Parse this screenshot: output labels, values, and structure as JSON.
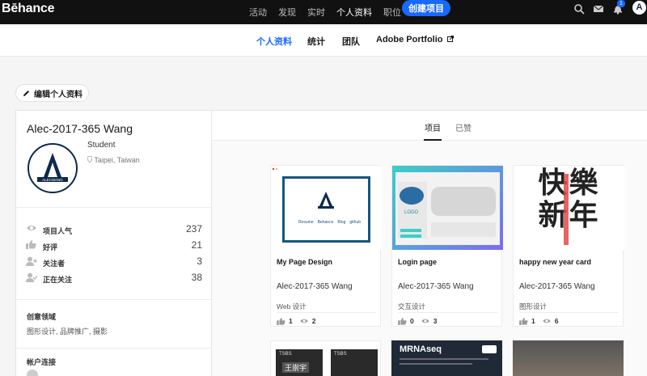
{
  "topbar": {
    "logo": "Bēhance",
    "nav": [
      "活动",
      "发现",
      "实时",
      "个人资料",
      "职位"
    ],
    "active_index": 3,
    "create_label": "创建项目",
    "notification_count": "1",
    "avatar_letter": "A"
  },
  "subnav": {
    "tabs": [
      "个人资料",
      "统计",
      "团队",
      "Adobe Portfolio"
    ],
    "active_index": 0
  },
  "edit_profile_label": "编辑个人资料",
  "profile": {
    "name": "Alec-2017-365 Wang",
    "occupation": "Student",
    "location": "Taipei, Taiwan",
    "avatar_text": "ALECWANG",
    "stats": [
      {
        "icon": "eye-icon",
        "label": "项目人气",
        "value": "237"
      },
      {
        "icon": "thumbs-up-icon",
        "label": "好评",
        "value": "21"
      },
      {
        "icon": "followers-icon",
        "label": "关注者",
        "value": "3"
      },
      {
        "icon": "following-icon",
        "label": "正在关注",
        "value": "38"
      }
    ],
    "creative_fields_title": "创意领域",
    "creative_fields": "图形设计, 品牌推广, 摄影",
    "accounts_title": "帐户连接"
  },
  "main": {
    "tabs": [
      "项目",
      "已赞"
    ],
    "active_index": 0,
    "projects": [
      {
        "title": "My Page Design",
        "owner": "Alec-2017-365 Wang",
        "field": "Web 设计",
        "likes": "1",
        "views": "2",
        "thumb_links": [
          "Resume",
          "Behance",
          "Blog",
          "github"
        ]
      },
      {
        "title": "Login page",
        "owner": "Alec-2017-365 Wang",
        "field": "交互设计",
        "likes": "0",
        "views": "3",
        "thumb_text": "LOGO"
      },
      {
        "title": "happy new year card",
        "owner": "Alec-2017-365 Wang",
        "field": "图形设计",
        "likes": "1",
        "views": "6",
        "thumb_text": "快樂新年"
      }
    ],
    "row2": [
      {
        "thumb_text_a": "TSBS",
        "thumb_text_b": "王崇宇"
      },
      {
        "thumb_text": "MRNAseq"
      }
    ]
  }
}
